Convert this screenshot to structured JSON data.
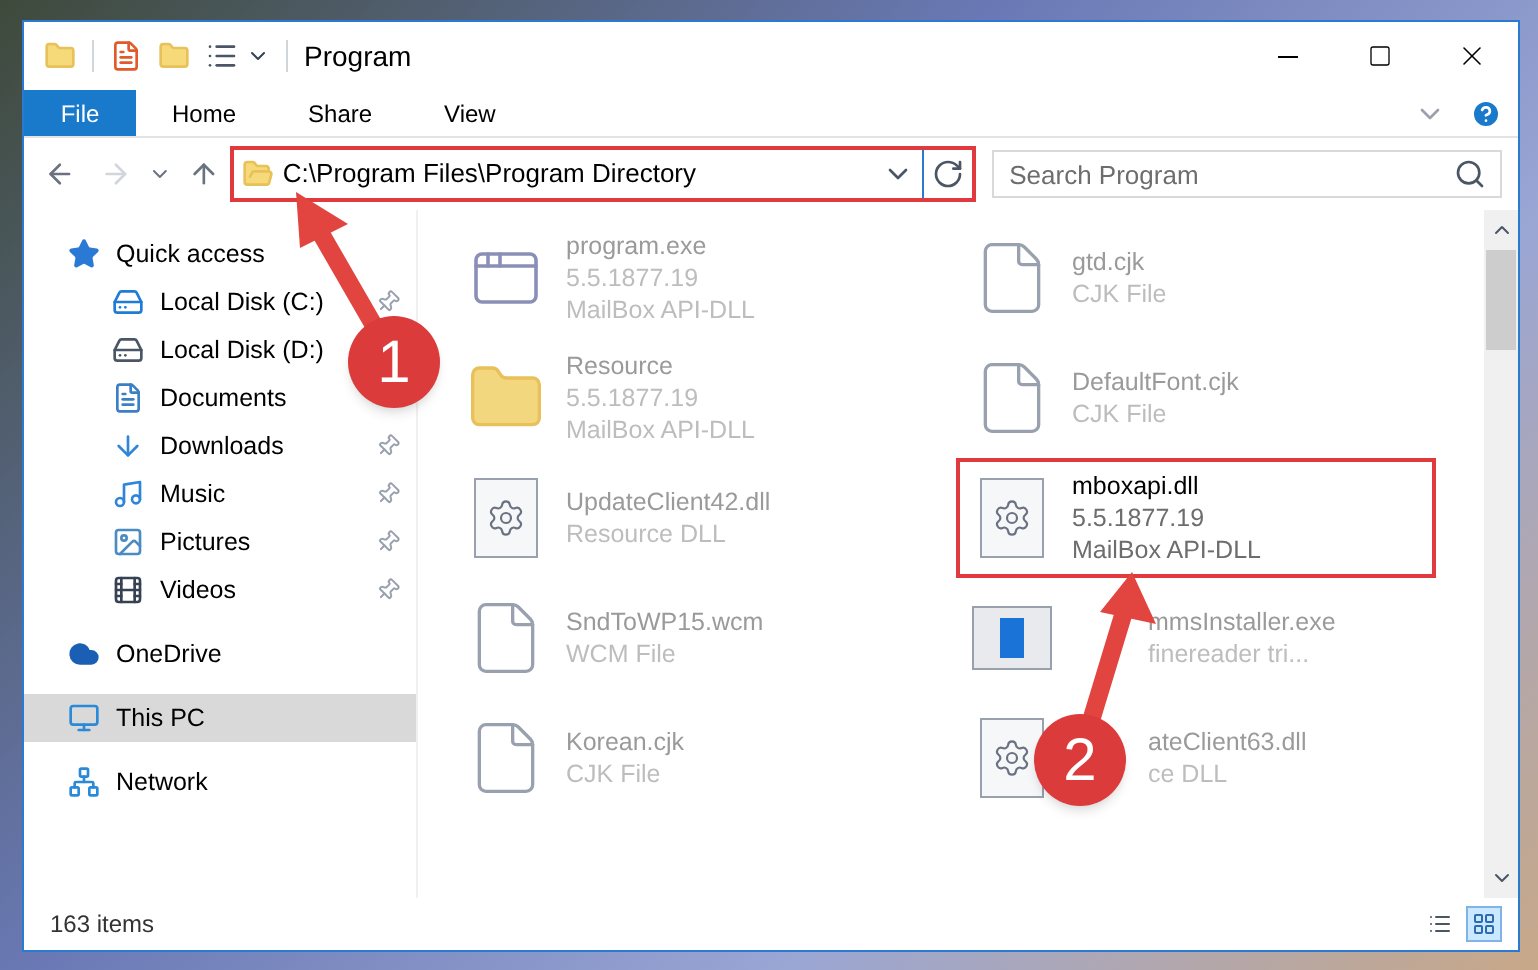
{
  "window": {
    "title": "Program"
  },
  "ribbon_tabs": [
    {
      "label": "File",
      "selected": true
    },
    {
      "label": "Home",
      "selected": false
    },
    {
      "label": "Share",
      "selected": false
    },
    {
      "label": "View",
      "selected": false
    }
  ],
  "address_bar": {
    "path": "C:\\Program Files\\Program Directory",
    "highlighted": true
  },
  "search": {
    "placeholder": "Search Program"
  },
  "navigation": [
    {
      "label": "Quick access",
      "kind": "star",
      "selected": false,
      "children": [
        {
          "label": "Local Disk (C:)",
          "kind": "drive_c",
          "pinned": true,
          "selected": false
        },
        {
          "label": "Local Disk (D:)",
          "kind": "drive",
          "pinned": false,
          "selected": false
        },
        {
          "label": "Documents",
          "kind": "documents",
          "pinned": false,
          "selected": false
        },
        {
          "label": "Downloads",
          "kind": "downloads",
          "pinned": true,
          "selected": false
        },
        {
          "label": "Music",
          "kind": "music",
          "pinned": true,
          "selected": false
        },
        {
          "label": "Pictures",
          "kind": "pictures",
          "pinned": true,
          "selected": false
        },
        {
          "label": "Videos",
          "kind": "videos",
          "pinned": true,
          "selected": false
        }
      ]
    },
    {
      "label": "OneDrive",
      "kind": "cloud",
      "selected": false
    },
    {
      "label": "This PC",
      "kind": "pc",
      "selected": true
    },
    {
      "label": "Network",
      "kind": "network",
      "selected": false
    }
  ],
  "files": [
    {
      "name": "program.exe",
      "kind": "exe",
      "highlighted": false,
      "details": [
        "5.5.1877.19",
        "MailBox API-DLL"
      ]
    },
    {
      "name": "gtd.cjk",
      "kind": "file",
      "highlighted": false,
      "details": [
        "CJK File"
      ]
    },
    {
      "name": "Resource",
      "kind": "folder",
      "highlighted": false,
      "details": [
        "5.5.1877.19",
        "MailBox API-DLL"
      ]
    },
    {
      "name": "DefaultFont.cjk",
      "kind": "file",
      "highlighted": false,
      "details": [
        "CJK File"
      ]
    },
    {
      "name": "UpdateClient42.dll",
      "kind": "dll",
      "highlighted": false,
      "details": [
        "Resource DLL"
      ]
    },
    {
      "name": "mboxapi.dll",
      "kind": "dll",
      "highlighted": true,
      "details": [
        "5.5.1877.19",
        "MailBox API-DLL"
      ]
    },
    {
      "name": "SndToWP15.wcm",
      "kind": "file",
      "highlighted": false,
      "details": [
        "WCM File"
      ]
    },
    {
      "name": "mmsInstaller.exe",
      "kind": "installer",
      "highlighted": false,
      "details": [
        "finereader tri..."
      ]
    },
    {
      "name": "Korean.cjk",
      "kind": "file",
      "highlighted": false,
      "details": [
        "CJK File"
      ]
    },
    {
      "name": "ateClient63.dll",
      "kind": "dll",
      "highlighted": false,
      "details": [
        "ce DLL"
      ]
    }
  ],
  "status_bar": {
    "item_count": "163 items"
  },
  "view_buttons": [
    {
      "kind": "details",
      "selected": false
    },
    {
      "kind": "large_icons",
      "selected": true
    }
  ],
  "annotations": [
    {
      "number": "1"
    },
    {
      "number": "2"
    }
  ]
}
